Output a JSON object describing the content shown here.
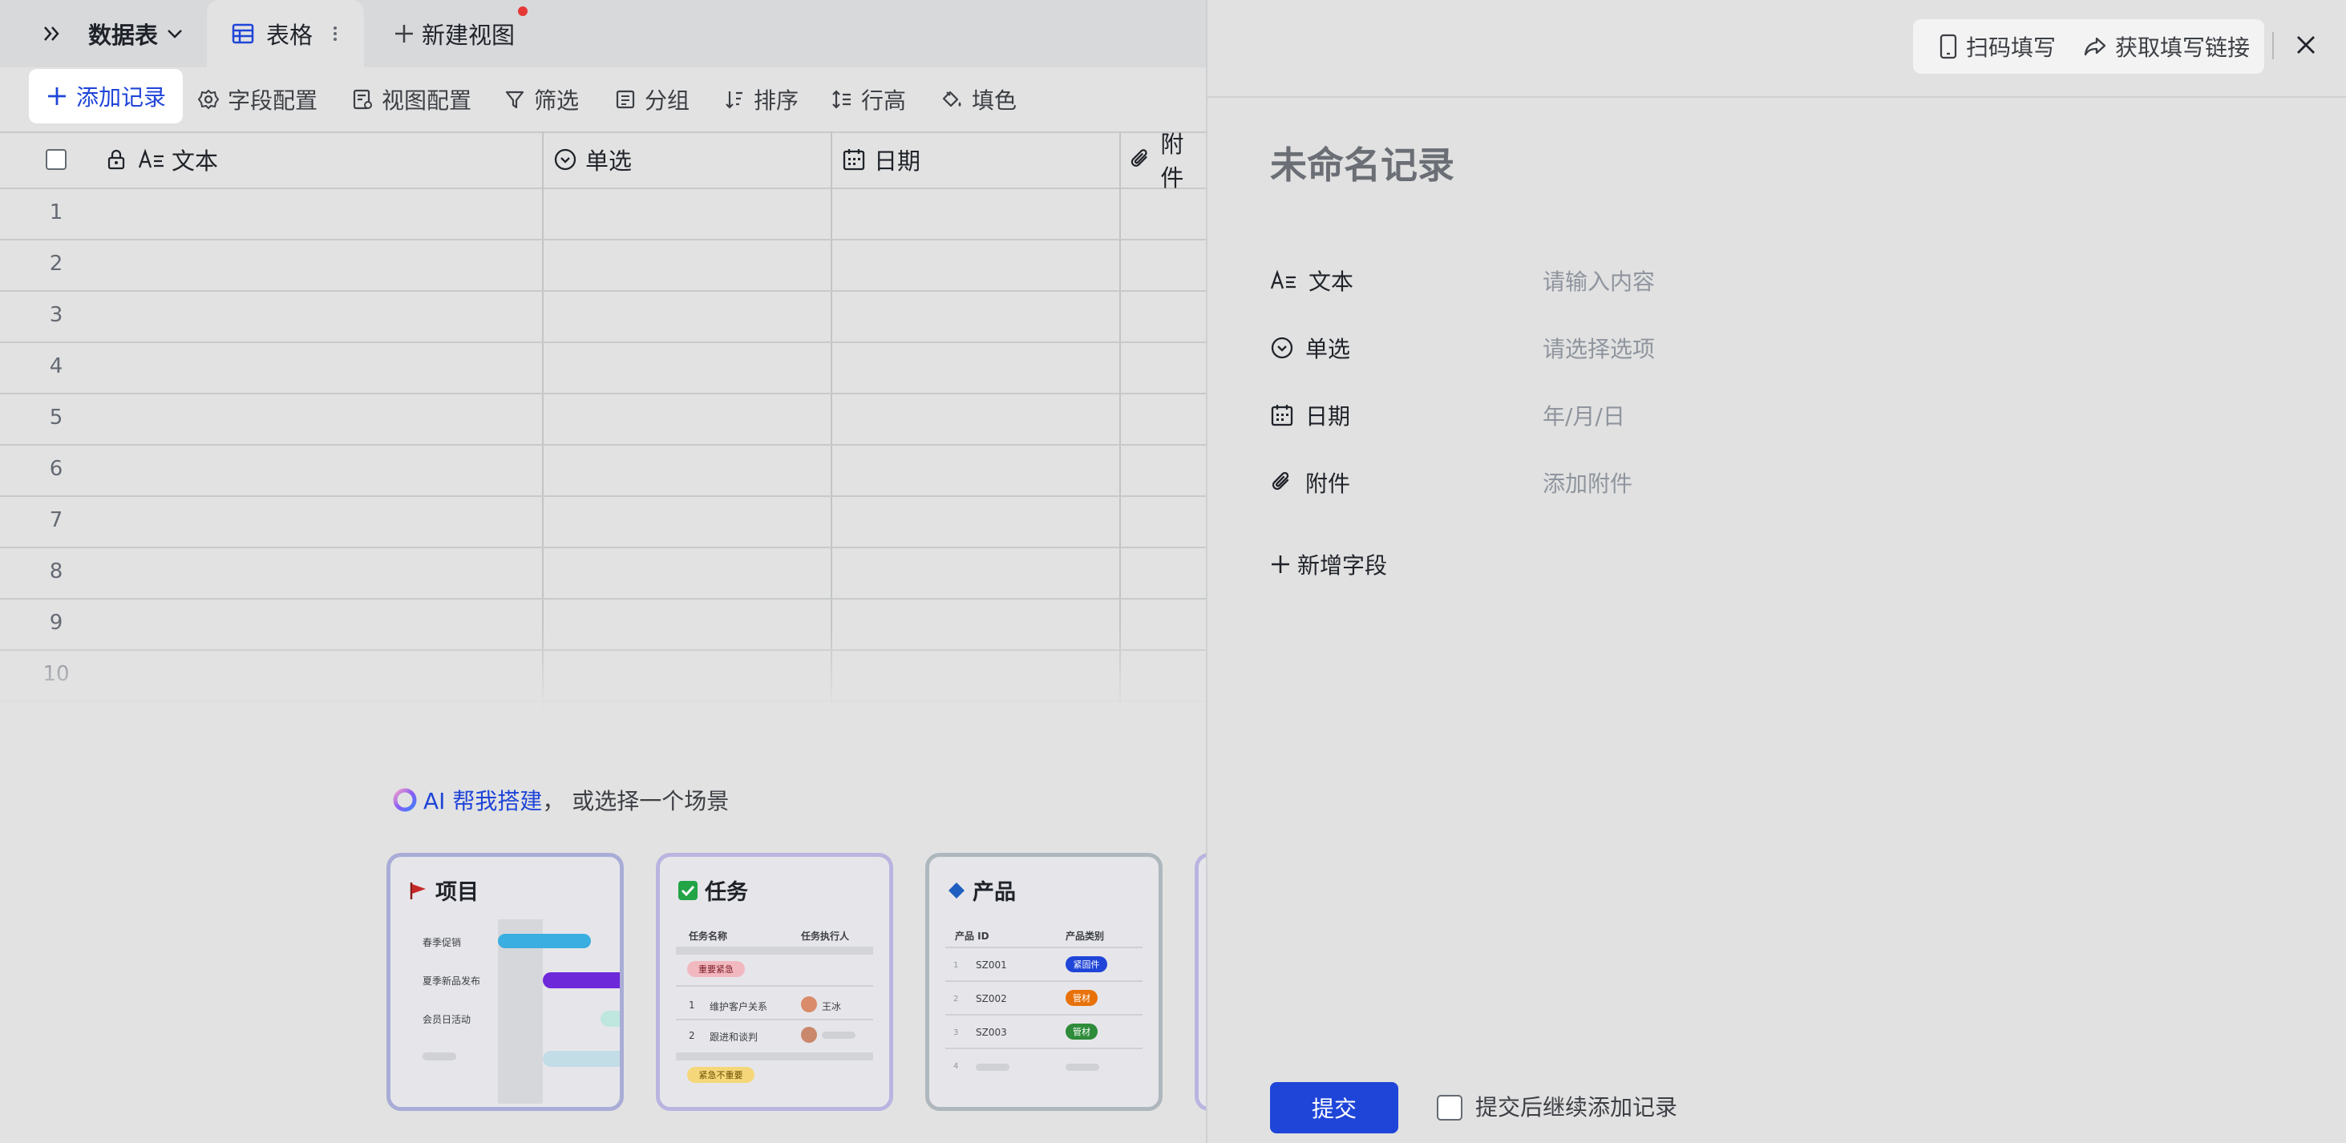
{
  "tabs": {
    "datasheet": "数据表",
    "grid_view": "表格",
    "new_view": "新建视图"
  },
  "toolbar": {
    "add_record": "添加记录",
    "field_config": "字段配置",
    "view_config": "视图配置",
    "filter": "筛选",
    "group": "分组",
    "sort": "排序",
    "row_height": "行高",
    "fill_color": "填色"
  },
  "grid": {
    "columns": [
      "文本",
      "单选",
      "日期",
      "附件"
    ],
    "rows": [
      "1",
      "2",
      "3",
      "4",
      "5",
      "6",
      "7",
      "8",
      "9",
      "10"
    ]
  },
  "scenes": {
    "ai_link": "AI 帮我搭建",
    "ai_rest": "， 或选择一个场景",
    "project": {
      "title": "项目",
      "items": [
        "春季促销",
        "夏季新品发布",
        "会员日活动"
      ]
    },
    "task": {
      "title": "任务",
      "col_name": "任务名称",
      "col_owner": "任务执行人",
      "tag_urgent": "重要紧急",
      "rows": [
        {
          "num": "1",
          "name": "维护客户关系",
          "owner": "王冰"
        },
        {
          "num": "2",
          "name": "跟进和谈判",
          "owner": ""
        }
      ],
      "tag_not": "紧急不重要"
    },
    "product": {
      "title": "产品",
      "col_id": "产品 ID",
      "col_cat": "产品类别",
      "rows": [
        {
          "num": "1",
          "id": "SZ001",
          "cat": "紧固件",
          "color": "#1f45d8"
        },
        {
          "num": "2",
          "id": "SZ002",
          "cat": "管材",
          "color": "#e8710a"
        },
        {
          "num": "3",
          "id": "SZ003",
          "cat": "管材",
          "color": "#2e8b3a"
        }
      ],
      "last_num": "4"
    }
  },
  "panel": {
    "scan_fill": "扫码填写",
    "get_link": "获取填写链接",
    "record_title": "未命名记录",
    "fields": [
      {
        "label": "文本",
        "placeholder": "请输入内容"
      },
      {
        "label": "单选",
        "placeholder": "请选择选项"
      },
      {
        "label": "日期",
        "placeholder": "年/月/日"
      },
      {
        "label": "附件",
        "placeholder": "添加附件"
      }
    ],
    "add_field": "新增字段",
    "submit": "提交",
    "continue_label": "提交后继续添加记录"
  },
  "colors": {
    "accent": "#1f45d8",
    "grid_line": "#c8c9cb",
    "panel_bg": "#e1e1e1"
  }
}
